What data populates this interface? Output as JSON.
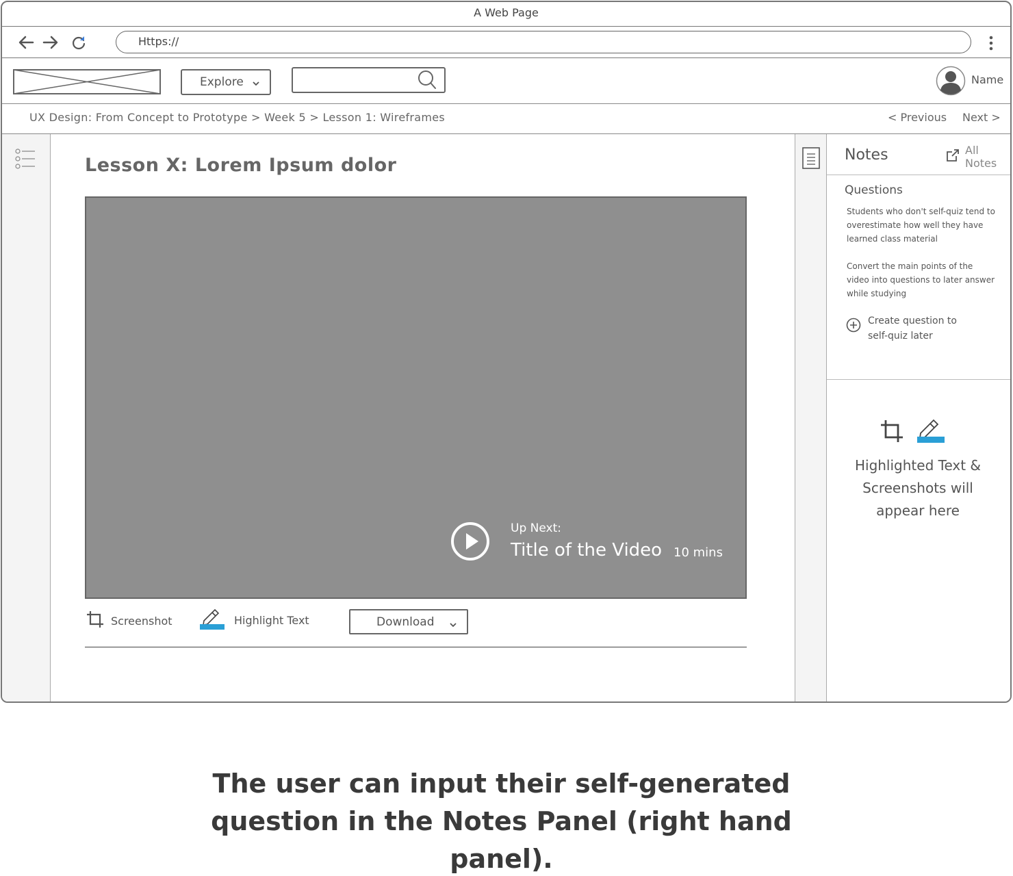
{
  "window": {
    "title": "A Web Page"
  },
  "browser": {
    "url": "Https://"
  },
  "header": {
    "explore_label": "Explore",
    "search_value": "",
    "user_name": "Name"
  },
  "breadcrumb": {
    "path": "UX Design: From Concept to Prototype > Week 5 > Lesson 1: Wireframes",
    "previous_label": "< Previous",
    "next_label": "Next >"
  },
  "lesson": {
    "title": "Lesson X: Lorem Ipsum dolor",
    "up_next_label": "Up Next:",
    "video_title": "Title of the Video",
    "duration": "10 mins"
  },
  "tools": {
    "screenshot_label": "Screenshot",
    "highlight_label": "Highlight Text",
    "download_label": "Download"
  },
  "notes": {
    "title": "Notes",
    "all_notes_label": "All Notes",
    "questions_title": "Questions",
    "question_1": "Students who don't self-quiz tend to overestimate how well they have learned class material",
    "question_2": "Convert the main points of the video into questions to later answer while studying",
    "create_question_label": "Create question to self-quiz later",
    "highlight_message": "Highlighted Text & Screenshots will appear here"
  },
  "caption": "The user can input their self-generated question in the Notes Panel (right hand panel).",
  "colors": {
    "highlight_accent": "#2a9fd6",
    "video_bg": "#8f8f8f",
    "border": "#777777"
  }
}
